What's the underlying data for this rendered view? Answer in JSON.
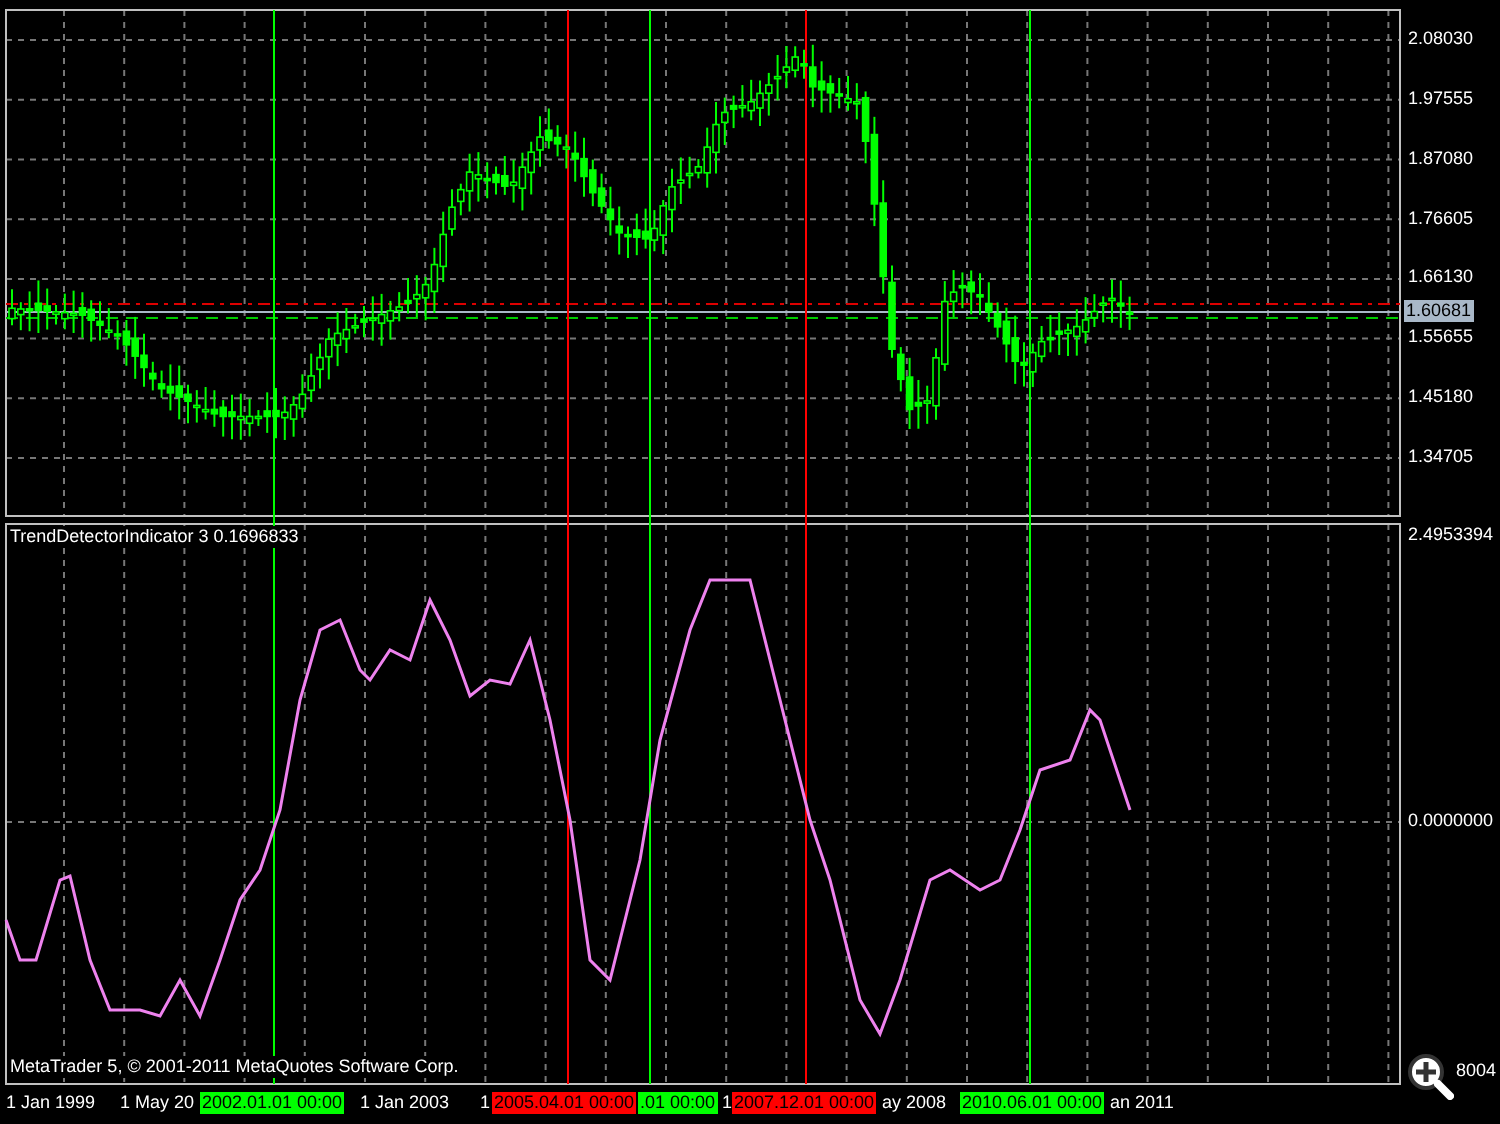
{
  "price_pane": {
    "scale_labels": [
      "2.08030",
      "1.97555",
      "1.87080",
      "1.76605",
      "1.66130",
      "1.55655",
      "1.45180",
      "1.34705"
    ],
    "current_price": "1.60681"
  },
  "indicator_pane": {
    "title": "TrendDetectorIndicator 3 0.1696833",
    "scale_labels": [
      "2.4953394",
      "0.0000000",
      "8004"
    ],
    "copyright": "MetaTrader 5, © 2001-2011 MetaQuotes Software Corp."
  },
  "markers": [
    {
      "label": "2002.01.01 00:00",
      "color": "#00ff00"
    },
    {
      "label": "2005.04.01 00:00",
      "color": "#ff0000"
    },
    {
      "label": ".01 00:00",
      "color": "#00ff00"
    },
    {
      "label": "2007.12.01 00:00",
      "color": "#ff0000"
    },
    {
      "label": "2010.06.01 00:00",
      "color": "#00ff00"
    }
  ],
  "time_axis": {
    "labels": [
      "1 Jan 1999",
      "1 May 20",
      "1 Jan 2003",
      "1",
      "1",
      "ay 2008",
      "an 2011"
    ]
  }
}
